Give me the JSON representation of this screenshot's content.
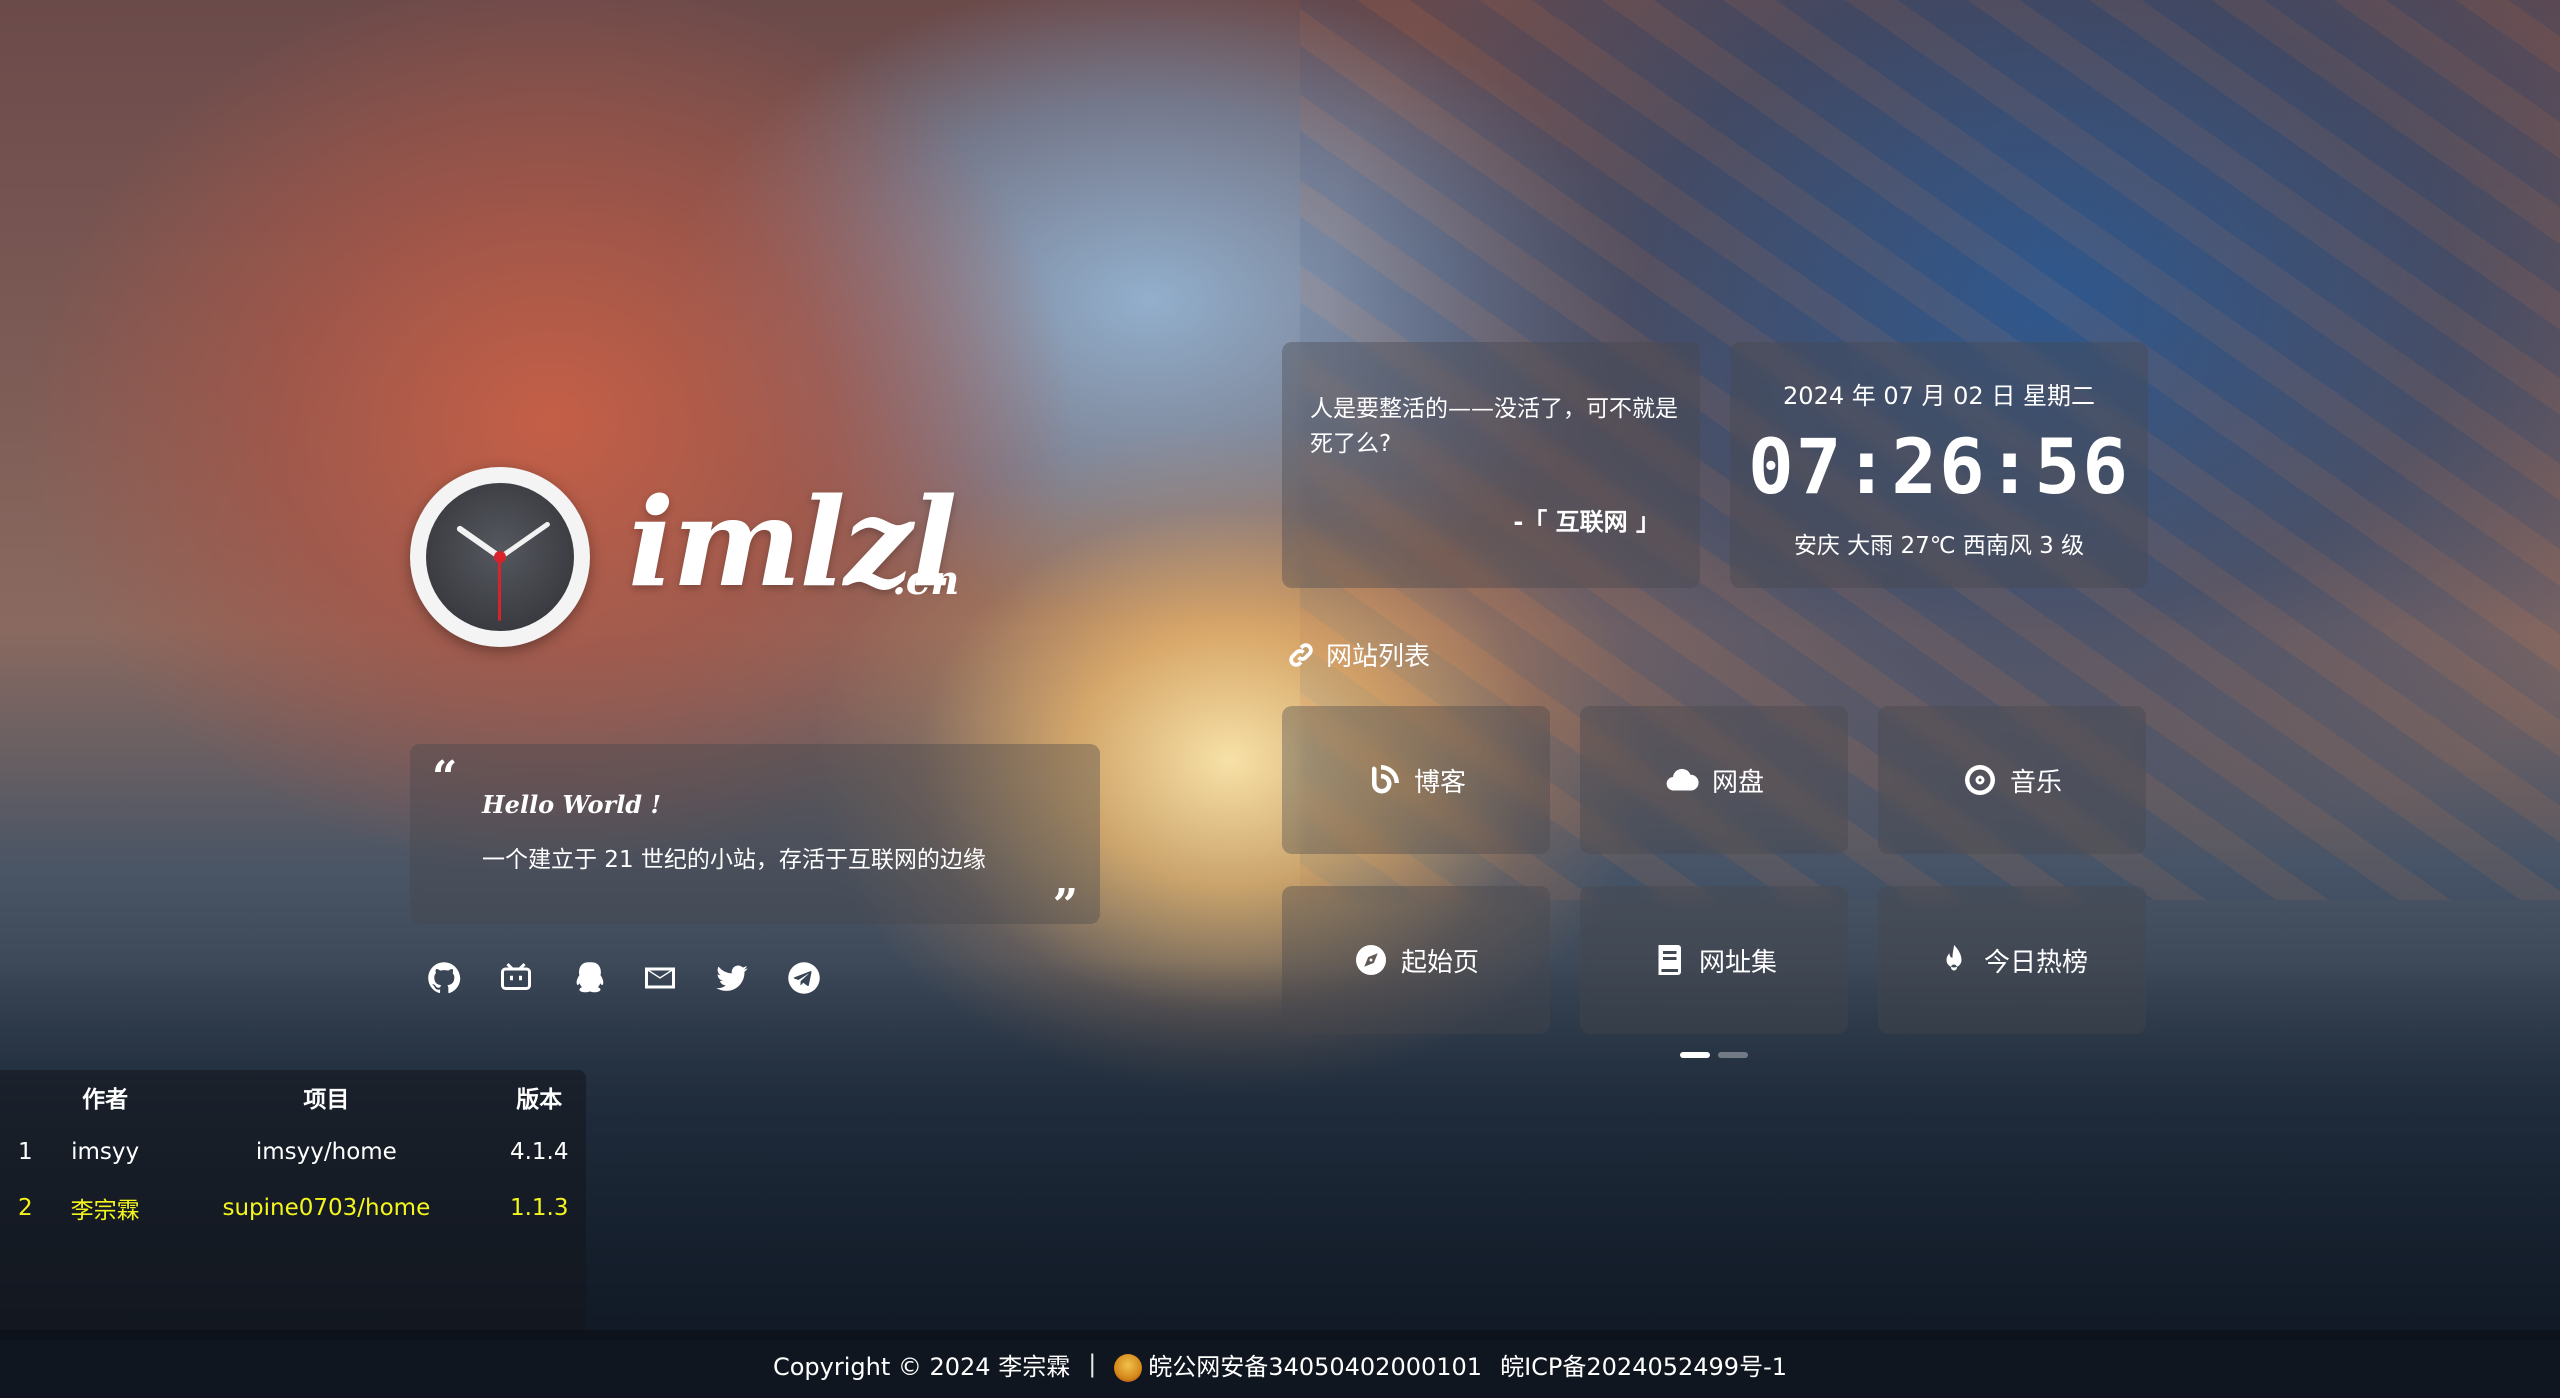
{
  "logo": {
    "text": "imlzl",
    "suffix": ".cn"
  },
  "hello": {
    "open_quote": "“",
    "close_quote": "”",
    "title": "Hello World !",
    "desc": "一个建立于 21 世纪的小站，存活于互联网的边缘"
  },
  "social": [
    {
      "name": "github-icon"
    },
    {
      "name": "bilibili-icon"
    },
    {
      "name": "qq-icon"
    },
    {
      "name": "mail-icon"
    },
    {
      "name": "twitter-icon"
    },
    {
      "name": "telegram-icon"
    }
  ],
  "table": {
    "headers": [
      "",
      "作者",
      "项目",
      "版本"
    ],
    "rows": [
      {
        "idx": "1",
        "author": "imsyy",
        "project": "imsyy/home",
        "version": "4.1.4"
      },
      {
        "idx": "2",
        "author": "李宗霖",
        "project": "supine0703/home",
        "version": "1.1.3"
      }
    ],
    "highlight_color": "#f5f51e"
  },
  "quote": {
    "text": "人是要整活的——没活了，可不就是死了么?",
    "source": "-「 互联网 」"
  },
  "clock": {
    "date": "2024 年 07 月 02 日 星期二",
    "time": "07:26:56",
    "weather": "安庆 大雨 27℃ 西南风 3 级"
  },
  "sites": {
    "heading": "网站列表",
    "items": [
      {
        "label": "博客",
        "icon": "blog-icon"
      },
      {
        "label": "网盘",
        "icon": "cloud-icon"
      },
      {
        "label": "音乐",
        "icon": "music-icon"
      },
      {
        "label": "起始页",
        "icon": "compass-icon"
      },
      {
        "label": "网址集",
        "icon": "book-icon"
      },
      {
        "label": "今日热榜",
        "icon": "fire-icon"
      }
    ],
    "page_indicator": {
      "pages": 2,
      "active": 1
    }
  },
  "footer": {
    "copyright": "Copyright © 2024 李宗霖",
    "separator": "|",
    "police": "皖公网安备34050402000101",
    "icp": "皖ICP备2024052499号-1"
  }
}
